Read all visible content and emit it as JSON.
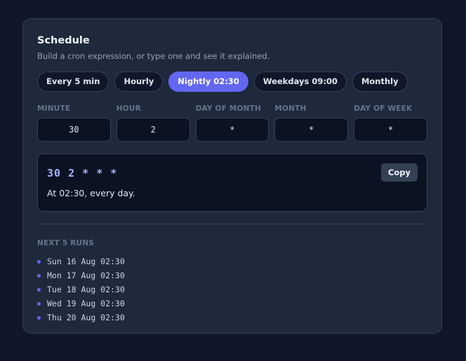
{
  "header": {
    "title": "Schedule",
    "subtitle": "Build a cron expression, or type one and see it explained."
  },
  "presets": [
    {
      "label": "Every 5 min",
      "active": false
    },
    {
      "label": "Hourly",
      "active": false
    },
    {
      "label": "Nightly 02:30",
      "active": true
    },
    {
      "label": "Weekdays 09:00",
      "active": false
    },
    {
      "label": "Monthly",
      "active": false
    }
  ],
  "fields": {
    "minute": {
      "label": "MINUTE",
      "value": "30"
    },
    "hour": {
      "label": "HOUR",
      "value": "2"
    },
    "day_of_month": {
      "label": "DAY OF MONTH",
      "value": "*"
    },
    "month": {
      "label": "MONTH",
      "value": "*"
    },
    "day_of_week": {
      "label": "DAY OF WEEK",
      "value": "*"
    }
  },
  "result": {
    "expression": "30 2 * * *",
    "explanation": "At 02:30, every day.",
    "copy_label": "Copy"
  },
  "runs": {
    "label": "NEXT 5 RUNS",
    "items": [
      "Sun 16 Aug 02:30",
      "Mon 17 Aug 02:30",
      "Tue 18 Aug 02:30",
      "Wed 19 Aug 02:30",
      "Thu 20 Aug 02:30"
    ]
  },
  "colors": {
    "background": "#0f1729",
    "card": "#1e293b",
    "accent": "#6366f1",
    "expression": "#a5b4fc"
  }
}
